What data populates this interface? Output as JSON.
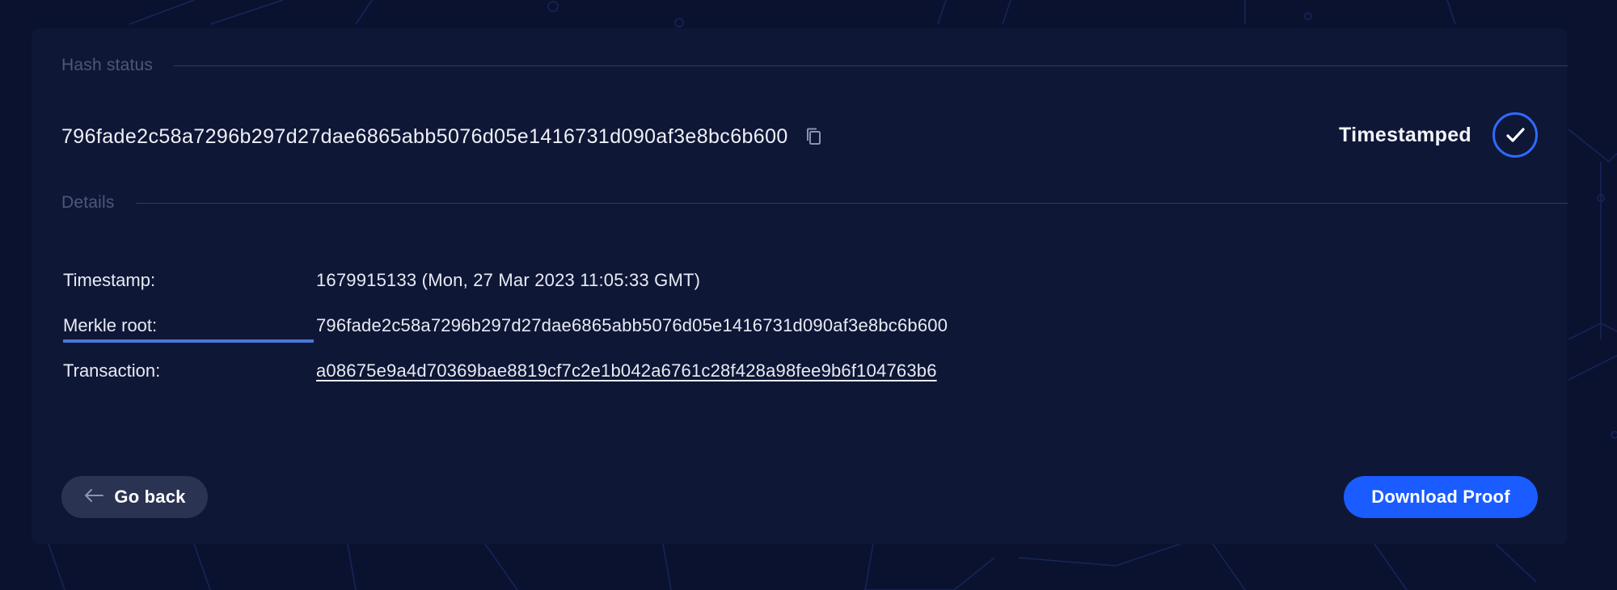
{
  "hash_status": {
    "section_title": "Hash status",
    "hash": "796fade2c58a7296b297d27dae6865abb5076d05e1416731d090af3e8bc6b600",
    "copy_icon": "copy-icon",
    "status_label": "Timestamped",
    "status_icon": "checkmark-icon"
  },
  "details": {
    "section_title": "Details",
    "rows": [
      {
        "label": "Timestamp:",
        "value": "1679915133 (Mon, 27 Mar 2023 11:05:33 GMT)"
      },
      {
        "label": "Merkle root:",
        "value": "796fade2c58a7296b297d27dae6865abb5076d05e1416731d090af3e8bc6b600"
      },
      {
        "label": "Transaction:",
        "value": "a08675e9a4d70369bae8819cf7c2e1b042a6761c28f428a98fee9b6f104763b6"
      }
    ]
  },
  "actions": {
    "back_label": "Go back",
    "back_icon": "arrow-left-icon",
    "download_label": "Download Proof"
  },
  "colors": {
    "background": "#0b1230",
    "card": "#0f1737",
    "accent": "#1a5cff",
    "status_ring": "#2e6bff"
  }
}
